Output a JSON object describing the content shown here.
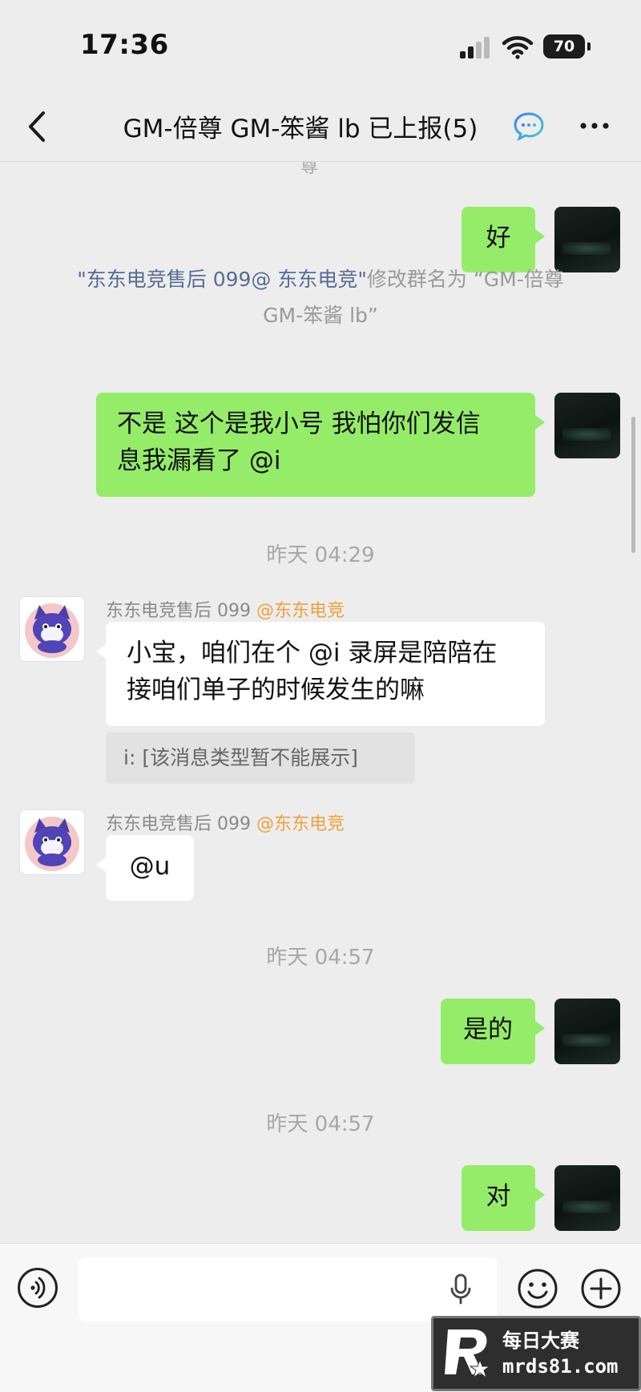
{
  "status_bar": {
    "time": "17:36",
    "battery": "70"
  },
  "header": {
    "title": "GM-倍尊 GM-笨酱 lb 已上报(5)"
  },
  "chat": {
    "clipped_text": "尊",
    "messages": [
      {
        "from": "me",
        "text": "好"
      },
      {
        "system_link": "\"东东电竞售后 099@ 东东电竞\"",
        "system_rest": "修改群名为 “GM-倍尊",
        "system_line2": "GM-笨酱  lb”"
      },
      {
        "from": "me",
        "line1": "不是 这个是我小号 我怕你们发信",
        "line2": "息我漏看了 @i"
      },
      {
        "timestamp": "昨天 04:29"
      },
      {
        "sender": "东东电竞售后 099",
        "sender_tag": "@东东电竞",
        "line1": "小宝，咱们在个 @i 录屏是陪陪在",
        "line2": "接咱们单子的时候发生的嘛",
        "quote": "i: [该消息类型暂不能展示]"
      },
      {
        "sender": "东东电竞售后 099",
        "sender_tag": "@东东电竞",
        "text": "@u"
      },
      {
        "timestamp": "昨天 04:57"
      },
      {
        "from": "me",
        "text": "是的"
      },
      {
        "timestamp": "昨天 04:57"
      },
      {
        "from": "me",
        "text": "对"
      }
    ]
  },
  "input": {
    "placeholder": ""
  },
  "watermark": {
    "cn": "每日大赛",
    "url": "mrds81.com"
  },
  "colors": {
    "my_bubble": "#95ec69",
    "link": "#576b95",
    "tag": "#f0a03c"
  }
}
